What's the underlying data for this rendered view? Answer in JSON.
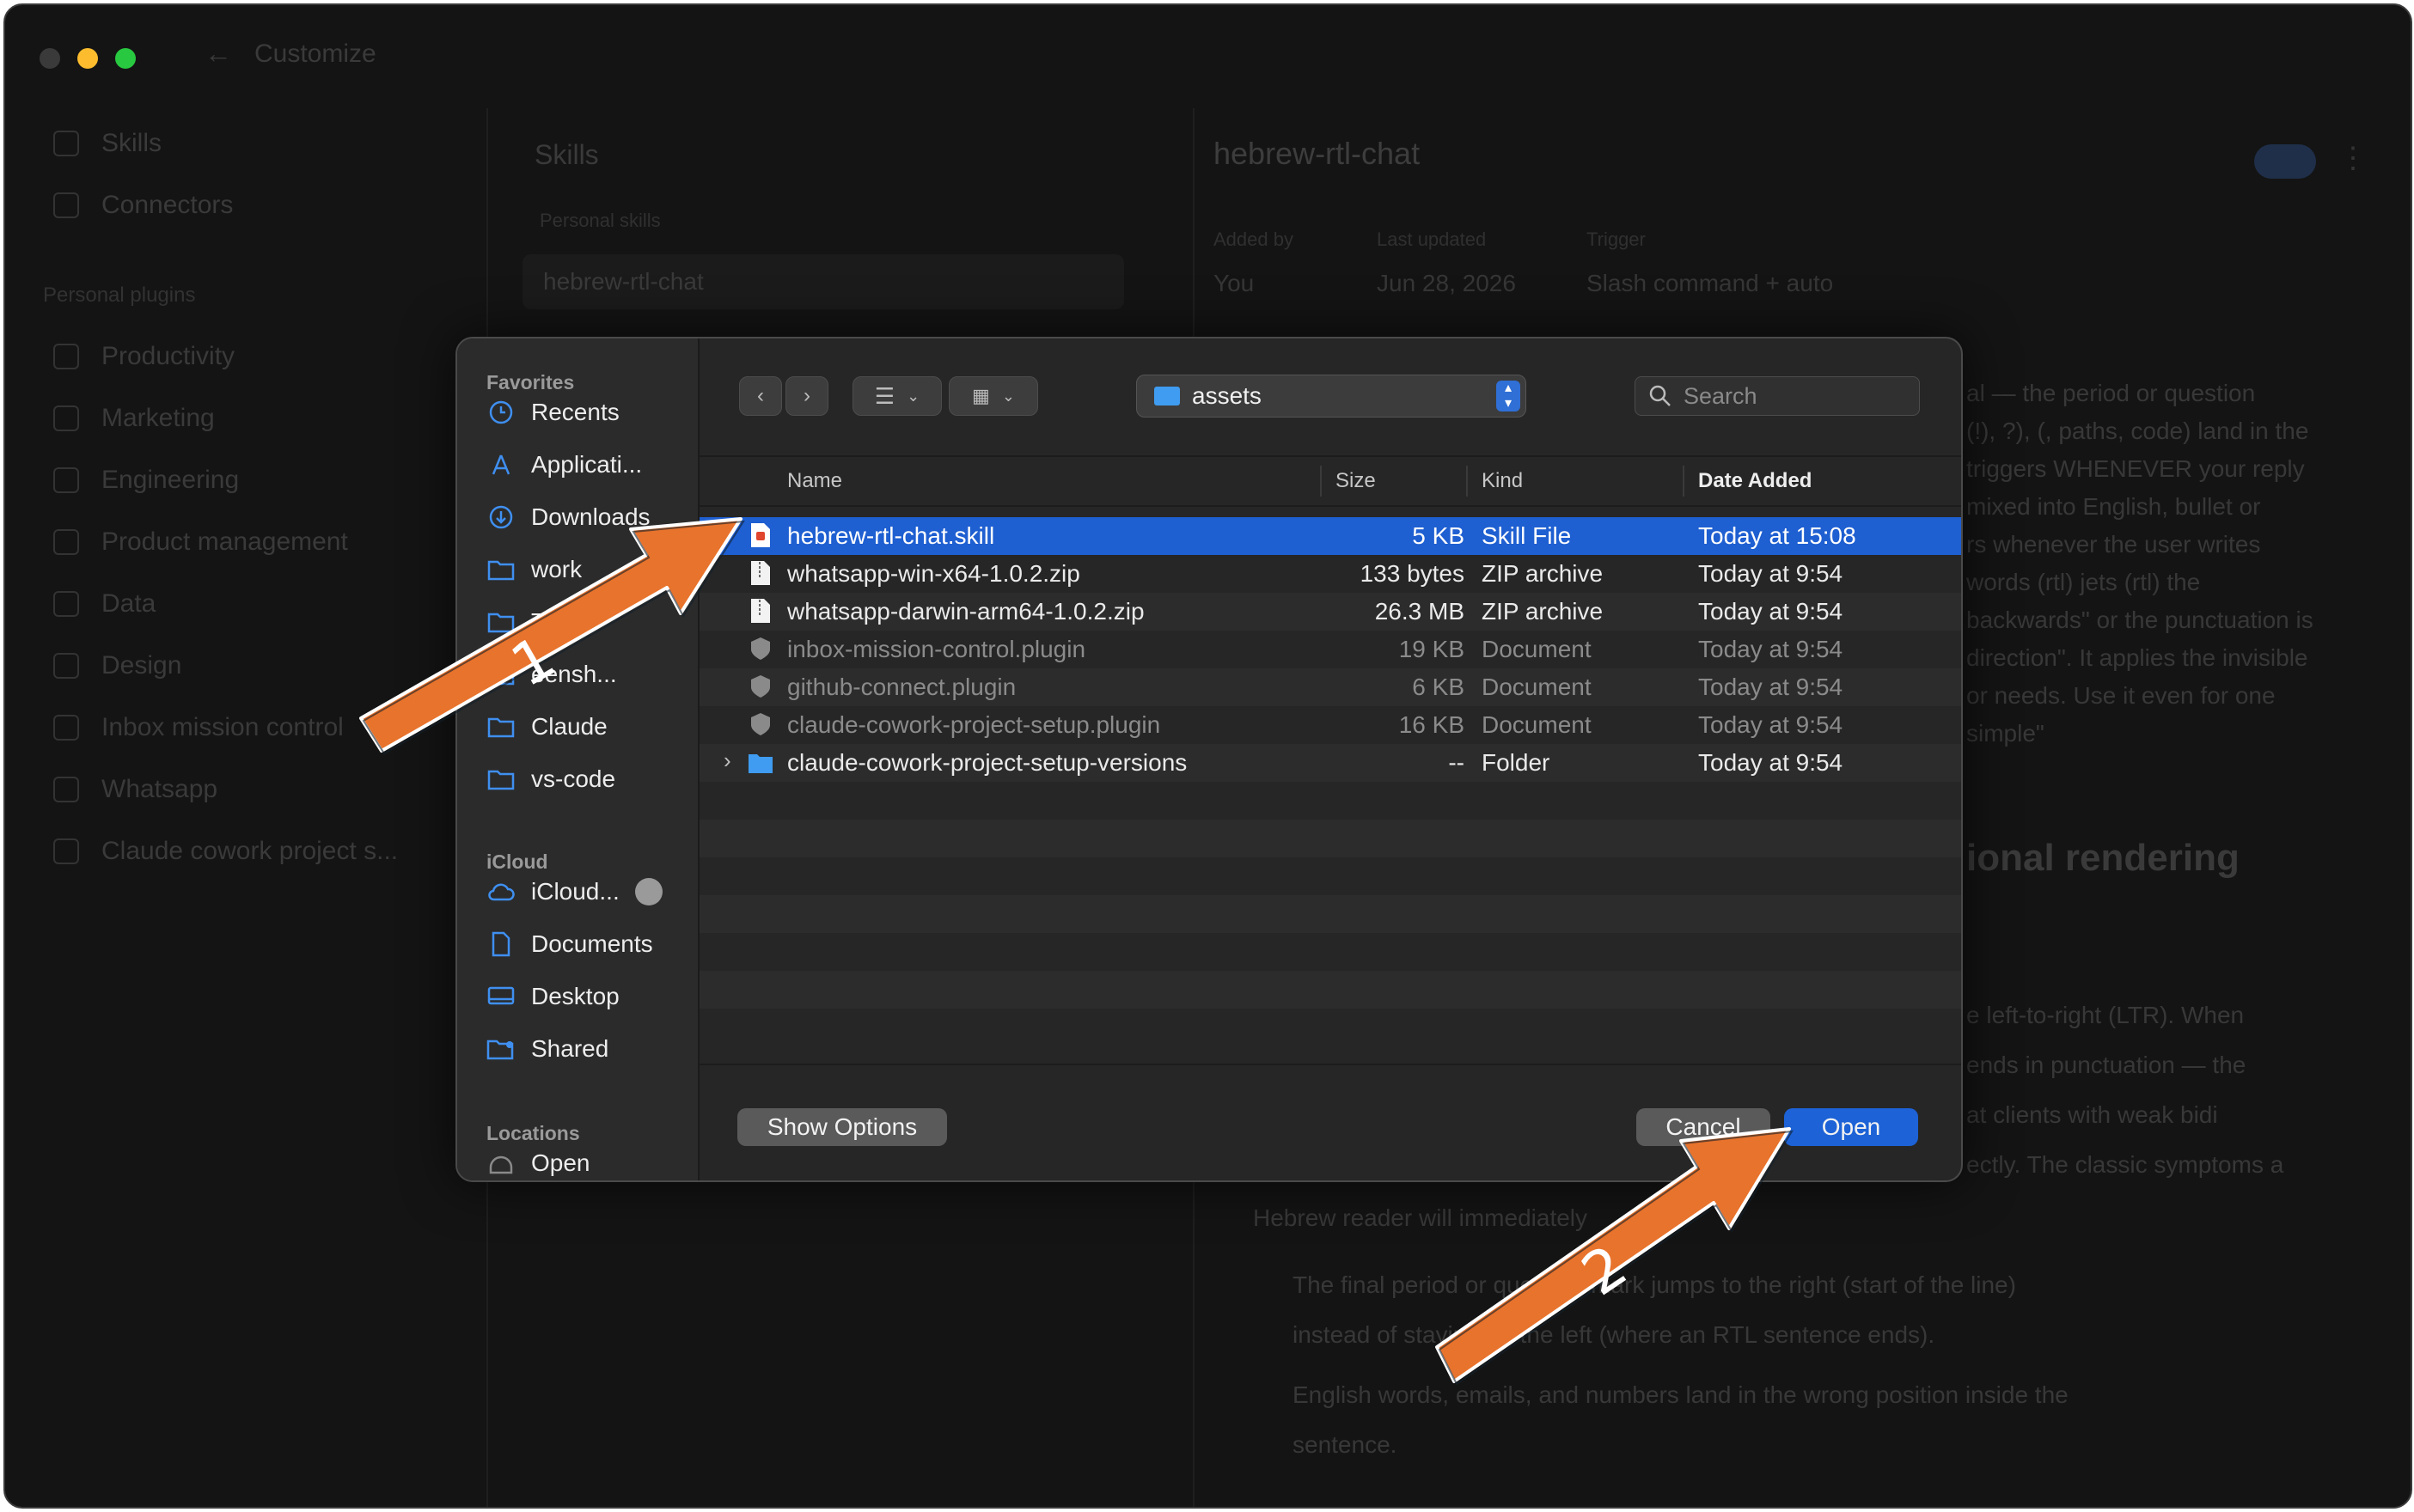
{
  "background_app": {
    "title": "Customize",
    "sidebar": {
      "items": [
        "Skills",
        "Connectors"
      ],
      "section_label": "Personal plugins",
      "plugins": [
        "Productivity",
        "Marketing",
        "Engineering",
        "Product management",
        "Data",
        "Design",
        "Inbox mission control",
        "Whatsapp",
        "Claude cowork project s..."
      ]
    },
    "skills_panel": {
      "title": "Skills",
      "group_label": "Personal skills",
      "selected_skill": "hebrew-rtl-chat"
    },
    "detail": {
      "title": "hebrew-rtl-chat",
      "meta_labels": [
        "Added by",
        "Last updated",
        "Trigger"
      ],
      "meta_values": [
        "You",
        "Jun 28, 2026",
        "Slash command + auto"
      ],
      "right_snippets": [
        "al — the period or question",
        "(!), ?), (, paths, code) land in the",
        "triggers WHENEVER your reply",
        "mixed into English, bullet or",
        "rs whenever the user writes",
        "words (rtl) jets (rtl) the",
        "backwards\" or the punctuation is",
        "direction\". It applies the invisible",
        "or needs. Use it even for one",
        "simple\""
      ],
      "heading": "ional rendering",
      "body_snippets": [
        "e left-to-right (LTR). When",
        "ends in punctuation — the",
        "at clients with weak bidi",
        "ectly. The classic symptoms a",
        "Hebrew reader will immediately"
      ],
      "bullets": [
        "The final period or question mark jumps to the right (start of the line)",
        "instead of staying on the left (where an RTL sentence ends).",
        "English words, emails, and numbers land in the wrong position inside the",
        "sentence."
      ]
    }
  },
  "dialog": {
    "sidebar": {
      "favorites_label": "Favorites",
      "favorites": [
        {
          "label": "Recents",
          "icon": "clock-icon"
        },
        {
          "label": "Applicati...",
          "icon": "applications-icon"
        },
        {
          "label": "Downloads",
          "icon": "download-icon"
        },
        {
          "label": "work",
          "icon": "folder-icon"
        },
        {
          "label": "Tr",
          "icon": "folder-icon"
        },
        {
          "label": "eensh...",
          "icon": "folder-icon"
        },
        {
          "label": "Claude",
          "icon": "folder-icon"
        },
        {
          "label": "vs-code",
          "icon": "folder-icon"
        }
      ],
      "icloud_label": "iCloud",
      "icloud": [
        {
          "label": "iCloud...",
          "icon": "cloud-icon"
        },
        {
          "label": "Documents",
          "icon": "document-icon"
        },
        {
          "label": "Desktop",
          "icon": "desktop-icon"
        },
        {
          "label": "Shared",
          "icon": "shared-folder-icon"
        }
      ],
      "locations_label": "Locations",
      "locations": [
        {
          "label": "Open",
          "icon": "disk-icon"
        }
      ]
    },
    "toolbar": {
      "current_folder": "assets",
      "search_placeholder": "Search"
    },
    "columns": {
      "name": "Name",
      "size": "Size",
      "kind": "Kind",
      "date": "Date Added"
    },
    "files": [
      {
        "name": "hebrew-rtl-chat.skill",
        "size": "5 KB",
        "kind": "Skill File",
        "date": "Today at 15:08"
      },
      {
        "name": "whatsapp-win-x64-1.0.2.zip",
        "size": "133 bytes",
        "kind": "ZIP archive",
        "date": "Today at 9:54"
      },
      {
        "name": "whatsapp-darwin-arm64-1.0.2.zip",
        "size": "26.3 MB",
        "kind": "ZIP archive",
        "date": "Today at 9:54"
      },
      {
        "name": "inbox-mission-control.plugin",
        "size": "19 KB",
        "kind": "Document",
        "date": "Today at 9:54"
      },
      {
        "name": "github-connect.plugin",
        "size": "6 KB",
        "kind": "Document",
        "date": "Today at 9:54"
      },
      {
        "name": "claude-cowork-project-setup.plugin",
        "size": "16 KB",
        "kind": "Document",
        "date": "Today at 9:54"
      },
      {
        "name": "claude-cowork-project-setup-versions",
        "size": "--",
        "kind": "Folder",
        "date": "Today at 9:54"
      }
    ],
    "buttons": {
      "show_options": "Show Options",
      "cancel": "Cancel",
      "open": "Open"
    }
  },
  "annotations": {
    "arrow1_label": "1",
    "arrow2_label": "2",
    "color": "#e8732c"
  }
}
